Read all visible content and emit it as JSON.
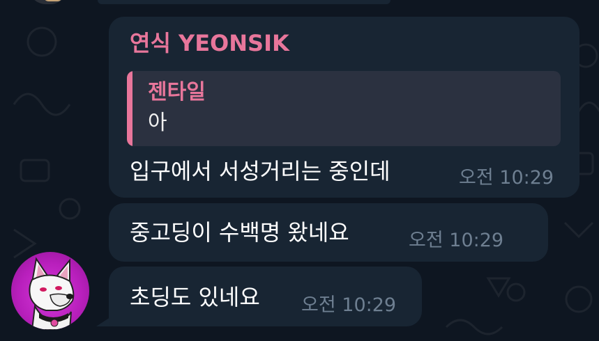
{
  "colors": {
    "background": "#0e1621",
    "bubble": "#182533",
    "accent_pink": "#e8769b",
    "reply_bg": "#2b3140",
    "time_text": "#6e7f91"
  },
  "messages": [
    {
      "sender": "연식 YEONSIK",
      "reply": {
        "name": "젠타일",
        "text": "아"
      },
      "text": "입구에서 서성거리는 중인데",
      "time": "오전 10:29"
    },
    {
      "text": "중고딩이 수백명 왔네요",
      "time": "오전 10:29"
    },
    {
      "text": "초딩도 있네요",
      "time": "오전 10:29"
    }
  ],
  "avatar": {
    "icon": "white-dog-avatar-icon"
  }
}
